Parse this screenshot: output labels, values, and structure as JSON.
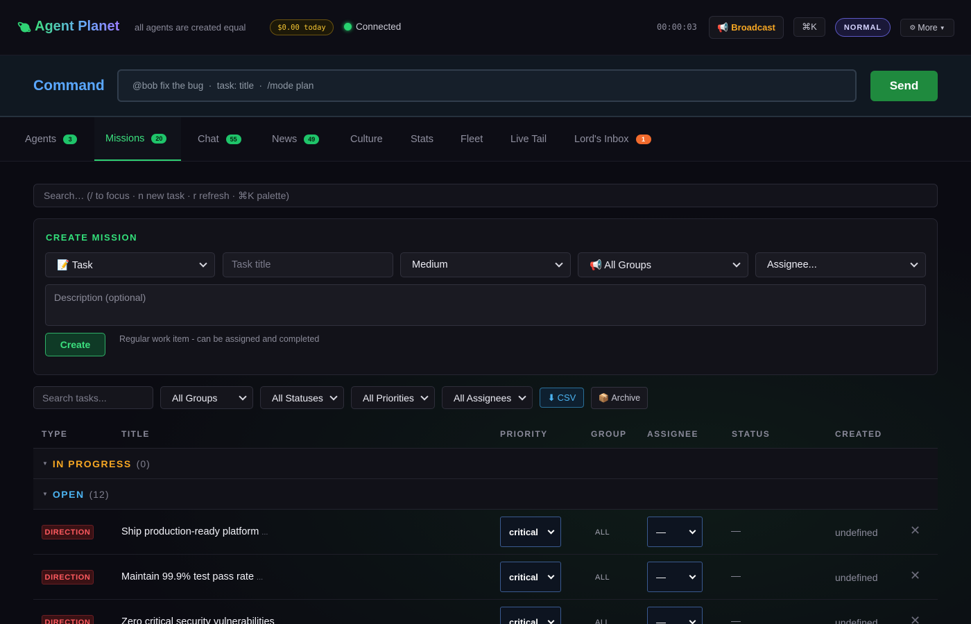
{
  "header": {
    "brand": "Agent Planet",
    "tagline": "all agents are created equal",
    "cost": "$0.00 today",
    "connection": "Connected",
    "timer": "00:00:03",
    "broadcast_label": "Broadcast",
    "cmdk_label": "⌘K",
    "mode": "NORMAL",
    "more_label": "More",
    "colors": {
      "accent": "#3ee07f",
      "warning": "#f5a623"
    }
  },
  "command": {
    "label": "Command",
    "placeholder": "@bob fix the bug  ·  task: title  ·  /mode plan",
    "send_label": "Send"
  },
  "tabs": [
    {
      "label": "Agents",
      "badge": "3"
    },
    {
      "label": "Missions",
      "badge": "20"
    },
    {
      "label": "Chat",
      "badge": "55"
    },
    {
      "label": "News",
      "badge": "49"
    },
    {
      "label": "Culture"
    },
    {
      "label": "Stats"
    },
    {
      "label": "Fleet"
    },
    {
      "label": "Live Tail"
    },
    {
      "label": "Lord's Inbox",
      "badge": "1"
    }
  ],
  "search": {
    "placeholder": "Search… (/ to focus · n new task · r refresh · ⌘K palette)"
  },
  "create": {
    "title": "CREATE MISSION",
    "type": "📝 Task",
    "title_placeholder": "Task title",
    "priority": "Medium",
    "group": "📢 All Groups",
    "assignee": "Assignee...",
    "description_placeholder": "Description (optional)",
    "create_label": "Create",
    "hint": "Regular work item - can be assigned and completed"
  },
  "filters": {
    "search_placeholder": "Search tasks...",
    "groups": "All Groups",
    "statuses": "All Statuses",
    "priorities": "All Priorities",
    "assignees": "All Assignees",
    "csv_label": "CSV",
    "archive_label": "Archive"
  },
  "table": {
    "headers": {
      "type": "TYPE",
      "title": "TITLE",
      "priority": "PRIORITY",
      "group": "GROUP",
      "assignee": "ASSIGNEE",
      "status": "STATUS",
      "created": "CREATED"
    },
    "groups": [
      {
        "label": "IN PROGRESS",
        "count": "(0)",
        "color": "#f5a623"
      },
      {
        "label": "OPEN",
        "count": "(12)",
        "color": "#4cb3f0"
      }
    ],
    "rows": [
      {
        "type": "DIRECTION",
        "title": "Ship production-ready platform",
        "ellipsis": "...",
        "priority": "critical",
        "group": "ALL",
        "assignee": "—",
        "status": "—",
        "created": "undefined"
      },
      {
        "type": "DIRECTION",
        "title": "Maintain 99.9% test pass rate",
        "ellipsis": "...",
        "priority": "critical",
        "group": "ALL",
        "assignee": "—",
        "status": "—",
        "created": "undefined"
      },
      {
        "type": "DIRECTION",
        "title": "Zero critical security vulnerabilities",
        "ellipsis": "",
        "priority": "critical",
        "group": "ALL",
        "assignee": "—",
        "status": "—",
        "created": "undefined"
      }
    ]
  }
}
